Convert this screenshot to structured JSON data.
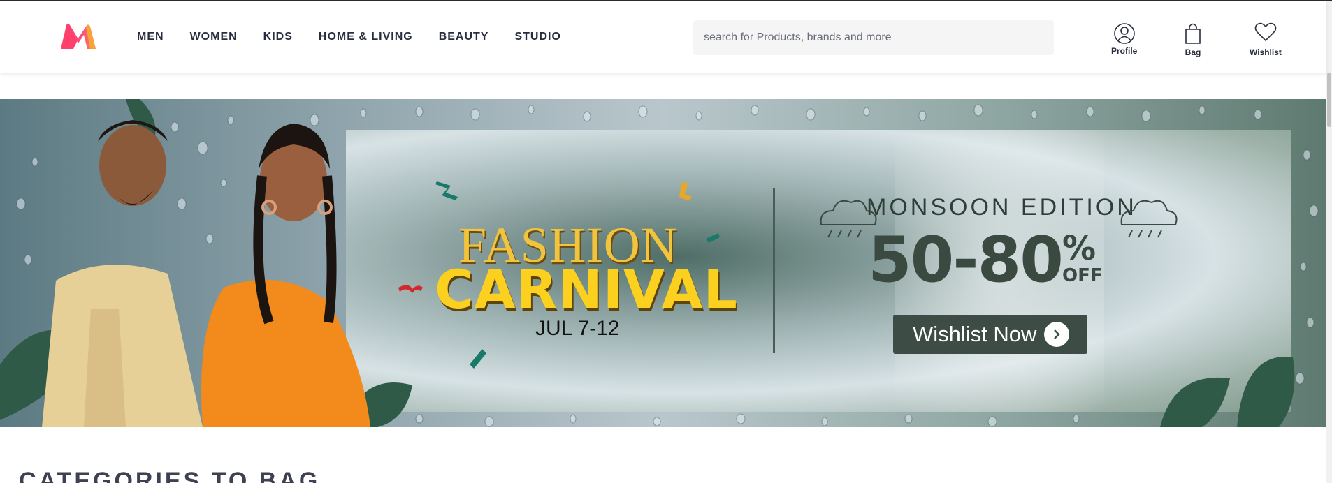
{
  "header": {
    "nav": [
      "MEN",
      "WOMEN",
      "KIDS",
      "HOME & LIVING",
      "BEAUTY",
      "STUDIO"
    ],
    "search_placeholder": "search for Products, brands and more",
    "actions": {
      "profile": "Profile",
      "bag": "Bag",
      "wishlist": "Wishlist"
    },
    "icons": {
      "logo": "myntra-logo",
      "profile": "user-icon",
      "bag": "bag-icon",
      "wishlist": "heart-icon"
    }
  },
  "banner": {
    "title_line1": "FASHION",
    "title_line2": "CARNIVAL",
    "dates": "JUL 7-12",
    "edition": "MONSOON EDITION",
    "discount": "50-80",
    "percent": "%",
    "off": "OFF",
    "cta": "Wishlist Now"
  },
  "section": {
    "title": "CATEGORIES TO BAG"
  },
  "colors": {
    "accent": "#ff3f6c",
    "banner_button": "#3d4d45",
    "carnival_yellow": "#fbd01f"
  }
}
